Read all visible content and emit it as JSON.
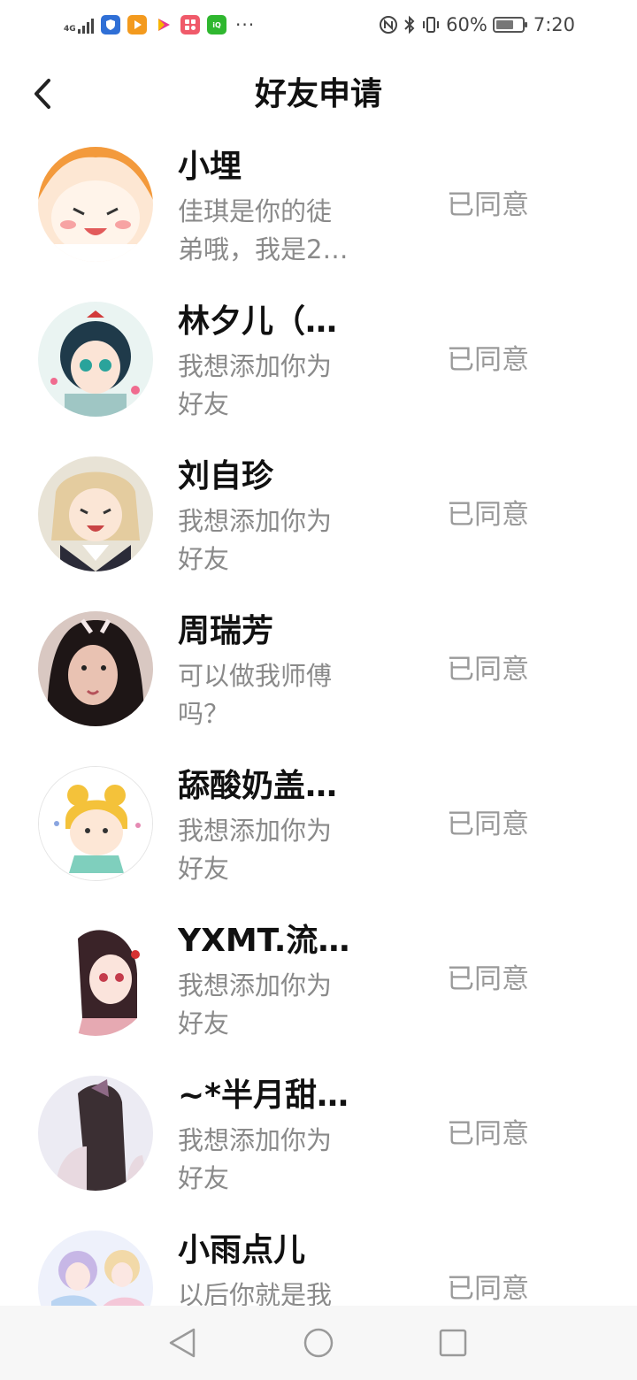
{
  "status_bar": {
    "network": "4G",
    "app_icons": [
      "shield-app-icon",
      "play-app-icon",
      "video-app-icon",
      "grid-app-icon",
      "iqiyi-app-icon"
    ],
    "more": "···",
    "battery": "60%",
    "time": "7:20"
  },
  "header": {
    "title": "好友申请"
  },
  "requests": [
    {
      "name": "小埋",
      "message": "佳琪是你的徒弟哦，我是2…",
      "status": "已同意"
    },
    {
      "name": "林夕儿（…",
      "message": "我想添加你为好友",
      "status": "已同意"
    },
    {
      "name": "刘自珍",
      "message": "我想添加你为好友",
      "status": "已同意"
    },
    {
      "name": "周瑞芳",
      "message": "可以做我师傅吗？",
      "status": "已同意"
    },
    {
      "name": "舔酸奶盖…",
      "message": "我想添加你为好友",
      "status": "已同意"
    },
    {
      "name": "YXMT.流…",
      "message": "我想添加你为好友",
      "status": "已同意"
    },
    {
      "name": "~*半月甜…",
      "message": "我想添加你为好友",
      "status": "已同意"
    },
    {
      "name": "小雨点儿",
      "message": "以后你就是我",
      "status": "已同意"
    }
  ],
  "colors": {
    "title": "#111111",
    "secondary_text": "#8a8a8a",
    "status_text": "#9a9a9a",
    "navbar_bg": "#f7f7f7"
  }
}
